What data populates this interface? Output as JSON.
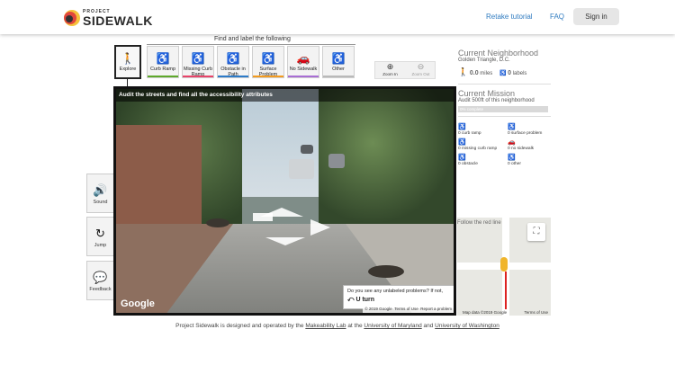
{
  "header": {
    "logo_small": "PROJECT",
    "logo_big": "SIDEWALK",
    "retake": "Retake tutorial",
    "faq": "FAQ",
    "signin": "Sign in"
  },
  "toolbar": {
    "find_label": "Find and label the following",
    "modes": [
      {
        "label": "Explore",
        "icon": "walking-person-icon"
      },
      {
        "label": "Curb Ramp",
        "icon": "curb-ramp-icon",
        "color": "#5ea82b"
      },
      {
        "label": "Missing Curb Ramp",
        "icon": "missing-curb-ramp-icon",
        "color": "#e8446a"
      },
      {
        "label": "Obstacle in Path",
        "icon": "obstacle-icon",
        "color": "#2d7bc8"
      },
      {
        "label": "Surface Problem",
        "icon": "surface-problem-icon",
        "color": "#f39b1f"
      },
      {
        "label": "No Sidewalk",
        "icon": "no-sidewalk-icon",
        "color": "#a86ed4"
      },
      {
        "label": "Other",
        "icon": "other-icon",
        "color": "#b9b9b9"
      }
    ],
    "zoom_in": "Zoom In",
    "zoom_out": "Zoom Out"
  },
  "side_buttons": {
    "sound": "Sound",
    "jump": "Jump",
    "feedback": "Feedback"
  },
  "pano": {
    "banner": "Audit the streets and find all the accessibility attributes",
    "google": "Google",
    "copyright": "© 2019 Google",
    "terms": "Terms of Use",
    "report": "Report a problem",
    "popup_text": "Do you see any unlabeled problems? If not,",
    "popup_action": "U turn"
  },
  "neighborhood": {
    "title": "Current Neighborhood",
    "name": "Golden Triangle, D.C.",
    "miles_value": "0.0",
    "miles_unit": "miles",
    "labels_value": "0",
    "labels_unit": "labels"
  },
  "mission": {
    "title": "Current Mission",
    "description": "Audit 500ft of this neighborhood",
    "progress_text": "0% complete",
    "labels": [
      {
        "text": "0 curb ramp",
        "icon": "curb-ramp-icon"
      },
      {
        "text": "0 surface problem",
        "icon": "surface-problem-icon"
      },
      {
        "text": "0 missing curb ramp",
        "icon": "missing-curb-ramp-icon"
      },
      {
        "text": "0 no sidewalk",
        "icon": "no-sidewalk-icon"
      },
      {
        "text": "0 obstacle",
        "icon": "obstacle-icon"
      },
      {
        "text": "0 other",
        "icon": "other-icon"
      }
    ]
  },
  "minimap": {
    "label": "Follow the red line",
    "copyright": "Map data ©2019 Google",
    "terms": "Terms of Use"
  },
  "footer": {
    "text1": "Project Sidewalk is designed and operated by the ",
    "link1": "Makeability Lab",
    "text2": " at the ",
    "link2": "University of Maryland",
    "text3": " and ",
    "link3": "University of Washington"
  }
}
